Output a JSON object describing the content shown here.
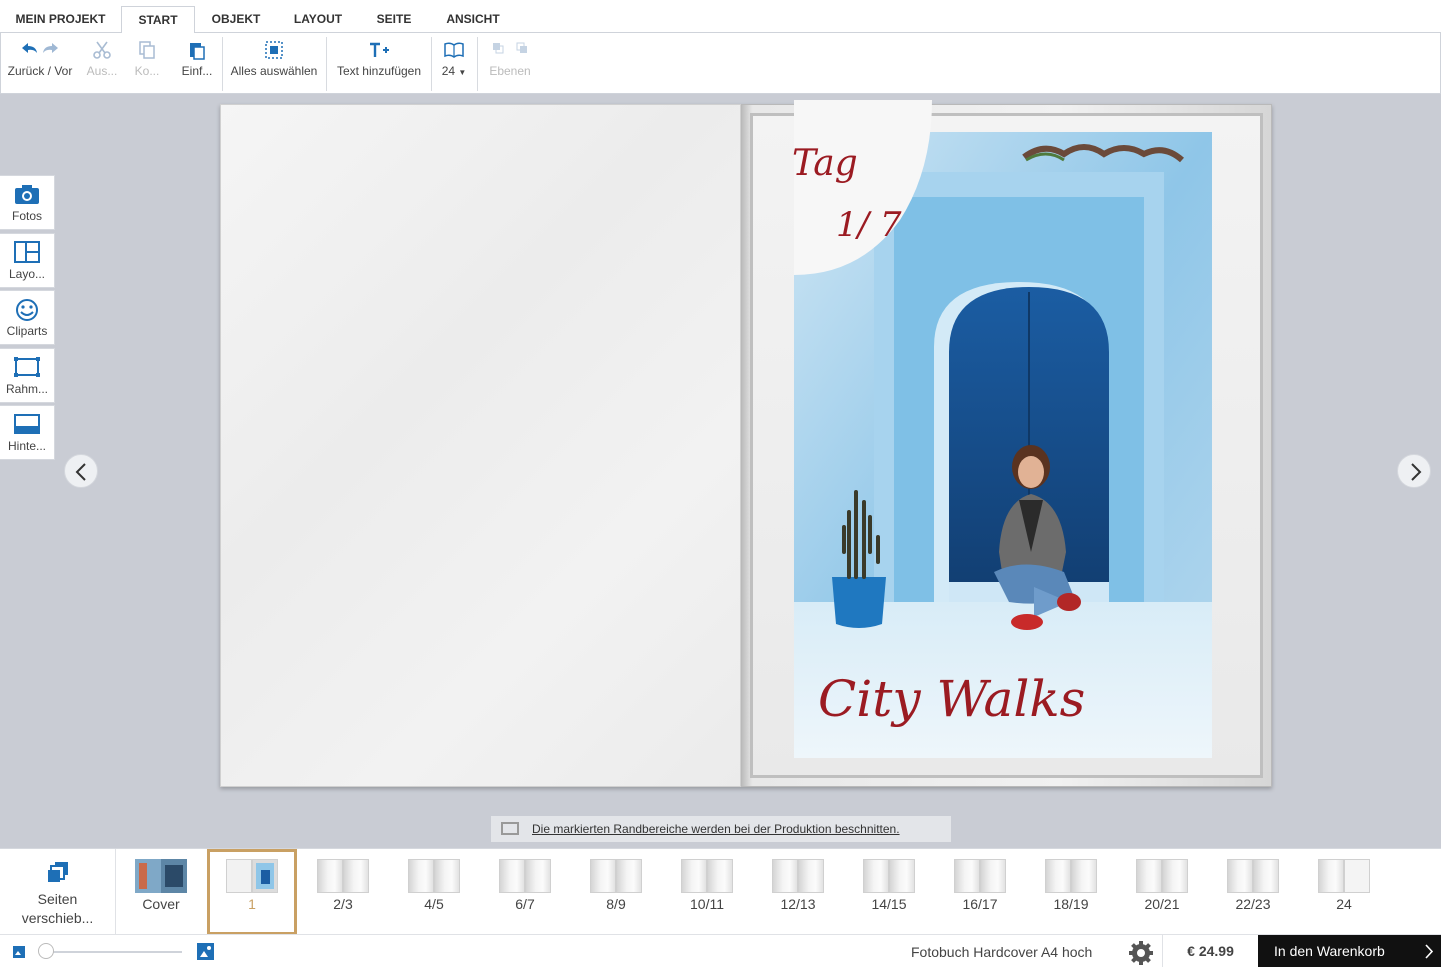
{
  "menu": {
    "tabs": [
      {
        "label": "MEIN PROJEKT"
      },
      {
        "label": "START"
      },
      {
        "label": "OBJEKT"
      },
      {
        "label": "LAYOUT"
      },
      {
        "label": "SEITE"
      },
      {
        "label": "ANSICHT"
      }
    ],
    "active": "START"
  },
  "toolbar": {
    "undo_redo": "Zurück / Vor",
    "cut": "Aus...",
    "copy": "Ko...",
    "paste": "Einf...",
    "select_all": "Alles auswählen",
    "add_text": "Text hinzufügen",
    "pages_count": "24",
    "layers": "Ebenen"
  },
  "side": {
    "photos": "Fotos",
    "layouts": "Layo...",
    "cliparts": "Cliparts",
    "frames": "Rahm...",
    "backgrounds": "Hinte..."
  },
  "page": {
    "title_line1": "Tag",
    "title_line2": "1/ 7",
    "caption": "City Walks"
  },
  "notice": "Die markierten Randbereiche werden bei der Produktion beschnitten.",
  "strip": {
    "move_pages": "Seiten verschieb...",
    "thumbs": [
      "Cover",
      "1",
      "2/3",
      "4/5",
      "6/7",
      "8/9",
      "10/11",
      "12/13",
      "14/15",
      "16/17",
      "18/19",
      "20/21",
      "22/23",
      "24"
    ],
    "selected": "1"
  },
  "status": {
    "product": "Fotobuch Hardcover A4 hoch",
    "price": "€ 24.99",
    "cart": "In den Warenkorb"
  },
  "colors": {
    "accent_blue": "#1e6fb6",
    "selected_border": "#c9a063",
    "title_red": "#9b1b22"
  }
}
